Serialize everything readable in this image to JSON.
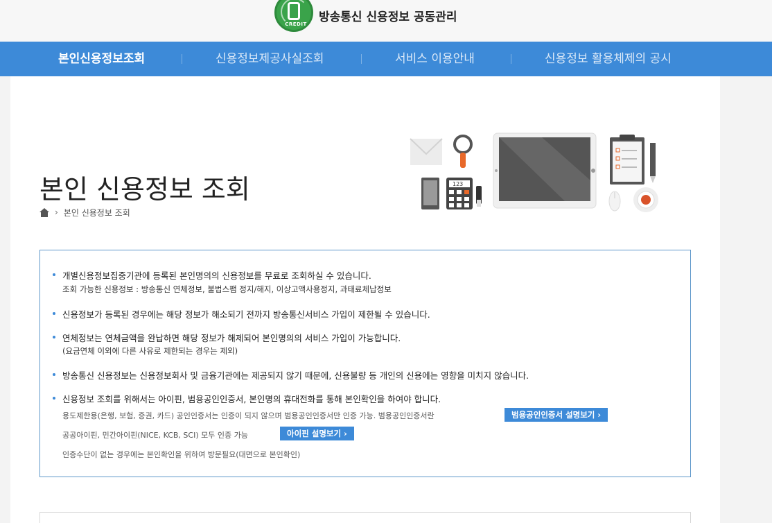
{
  "header": {
    "logo_text": "CREDIT",
    "site_title": "방송통신 신용정보 공동관리"
  },
  "nav": {
    "items": [
      {
        "label": "본인신용정보조회"
      },
      {
        "label": "신용정보제공사실조회"
      },
      {
        "label": "서비스 이용안내"
      },
      {
        "label": "신용정보 활용체제의 공시"
      }
    ]
  },
  "page": {
    "title": "본인 신용정보 조회",
    "breadcrumb": "본인 신용정보 조회"
  },
  "illustration": {
    "calculator_display": "123"
  },
  "info": {
    "b1": "개별신용정보집중기관에 등록된 본인명의의 신용정보를 무료로 조회하실 수 있습니다.",
    "b1_sub": "조회 가능한 신용정보 : 방송통신 연체정보, 불법스팸 정지/해지, 이상고액사용정지, 과태료체납정보",
    "b2": "신용정보가 등록된 경우에는 해당 정보가 해소되기 전까지 방송통신서비스 가입이 제한될 수 있습니다.",
    "b3": "연체정보는 연체금액을 완납하면 해당 정보가 해제되어 본인명의의 서비스 가입이 가능합니다.",
    "b3_sub": "(요금연체 이외에 다른 사유로 제한되는 경우는 제외)",
    "b4": "방송통신 신용정보는 신용정보회사 및 금융기관에는 제공되지 않기 때문에, 신용불량 등 개인의 신용에는 영향을 미치지 않습니다.",
    "b5": "신용정보 조회를 위해서는 아이핀, 범용공인인증서, 본인명의 휴대전화를 통해 본인확인을 하여야 합니다.",
    "b5_sub1": "용도제한용(은행, 보험, 증권, 카드) 공인인증서는 인증이 되지 않으며 범용공인인증서만 인증 가능. 범용공인인증서란",
    "cert_button": "범용공인인증서 설명보기 ›",
    "b5_sub2": "공공아이핀, 민간아이핀(NICE, KCB, SCI) 모두 인증 가능",
    "ipin_button": "아이핀 설명보기 ›",
    "b5_sub3": "인증수단이 없는 경우에는 본인확인을 위하여 방문필요(대면으로 본인확인)"
  },
  "colors": {
    "nav_bg": "#3d8ad8",
    "logo_green": "#3aa34a",
    "box_border": "#5c96c9"
  }
}
